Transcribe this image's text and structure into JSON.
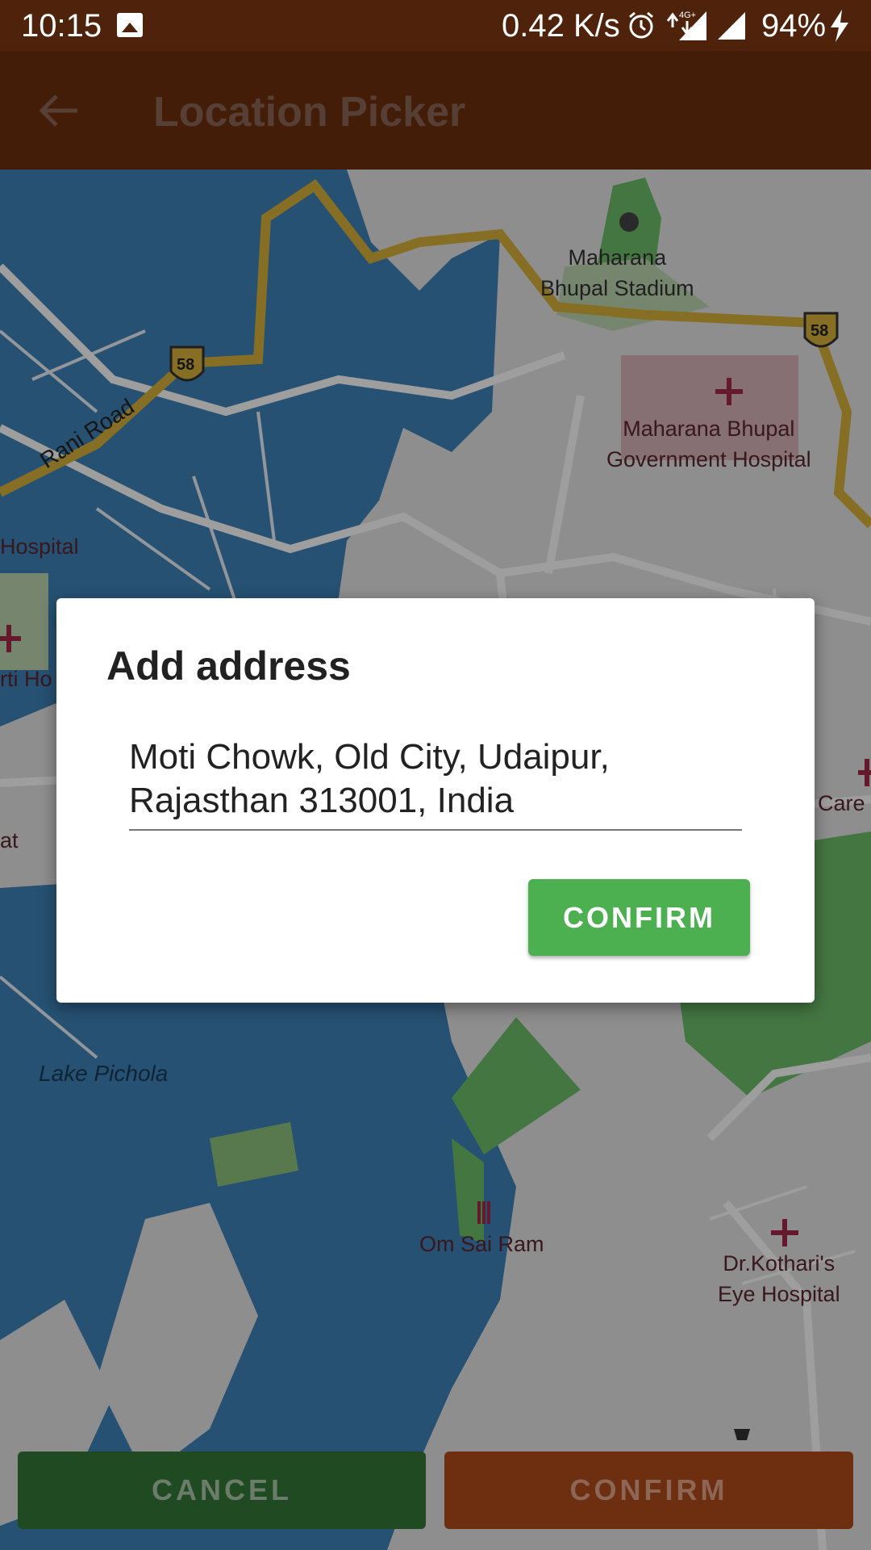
{
  "status_bar": {
    "time": "10:15",
    "speed": "0.42 K/s",
    "network": "4G+",
    "battery": "94%",
    "icons": [
      "image-icon",
      "alarm-icon",
      "network-icon",
      "signal-icon",
      "charging-icon"
    ]
  },
  "toolbar": {
    "title": "Location Picker",
    "back_icon": "arrow-left-icon"
  },
  "map": {
    "labels": {
      "stadium": "Maharana\nBhupal Stadium",
      "hospital_gov": "Maharana Bhupal\nGovernment Hospital",
      "hospital_left": "Hospital",
      "hospital_left2": "rti Ho",
      "care": "Care",
      "at": "at",
      "lake": "Lake Pichola",
      "om_sai_ram": "Om Sai Ram",
      "eye_hospital": "Dr.Kothari's\nEye Hospital",
      "rani_road": "Rani Road",
      "highway_shield": "58"
    },
    "colors": {
      "water": "#3e83b8",
      "land": "#e6e6e6",
      "park": "#6fbf6b",
      "road": "#ffffff",
      "highway": "#d9b33c"
    }
  },
  "dialog": {
    "title": "Add address",
    "address_value": "Moti Chowk, Old City, Udaipur, Rajasthan 313001, India",
    "confirm_label": "CONFIRM",
    "confirm_color": "#4caf50"
  },
  "bottom_bar": {
    "cancel_label": "CANCEL",
    "confirm_label": "CONFIRM"
  }
}
